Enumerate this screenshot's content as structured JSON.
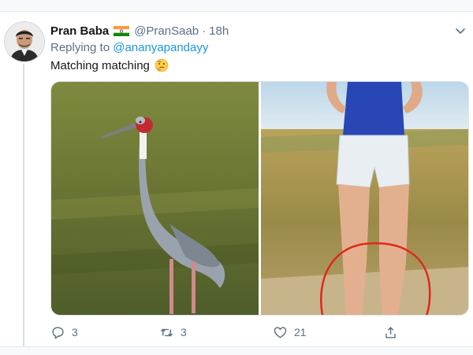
{
  "tweet": {
    "display_name": "Pran Baba",
    "flag_icon": "india-flag-icon",
    "handle": "@PranSaab",
    "separator": "·",
    "time": "18h",
    "reply_prefix": "Replying to ",
    "reply_mention": "@ananyapandayy",
    "text": "Matching matching",
    "text_emoji": "thinking-face-emoji",
    "media": [
      {
        "subject": "sarus-crane-photo"
      },
      {
        "subject": "woman-in-field-photo"
      }
    ]
  },
  "actions": {
    "reply_count": "3",
    "retweet_count": "3",
    "like_count": "21"
  },
  "colors": {
    "link": "#1b95e0",
    "secondary_text": "#5b7083",
    "annotation_red": "#e0281e"
  }
}
